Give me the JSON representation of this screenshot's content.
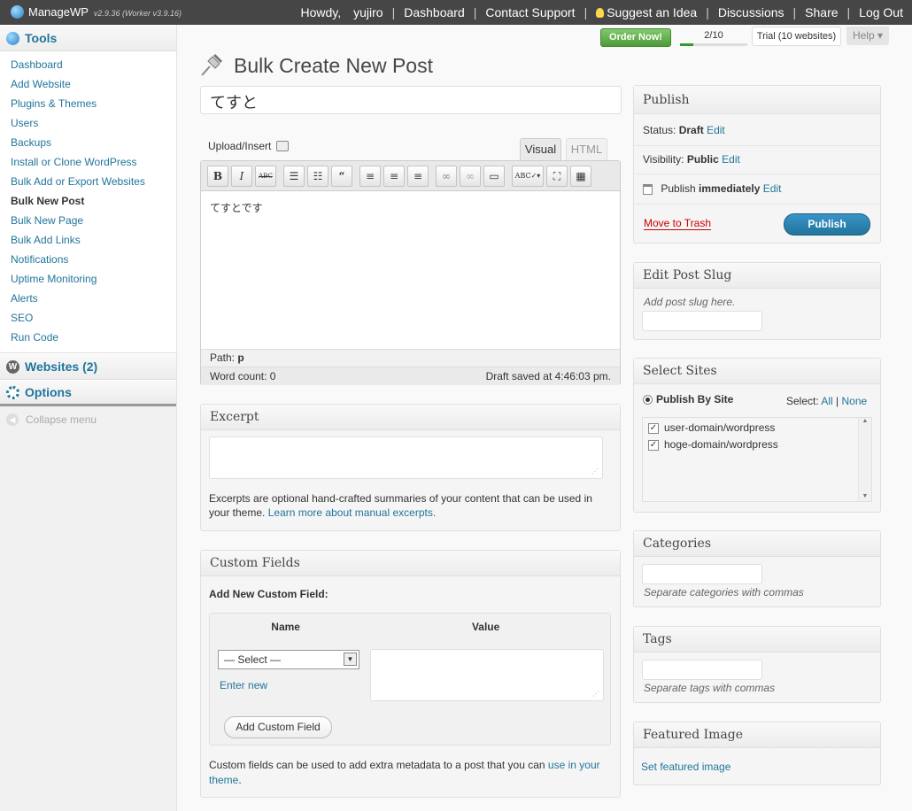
{
  "topbar": {
    "app_name": "ManageWP",
    "version": "v2.9.36 (Worker v3.9.16)",
    "howdy": "Howdy,",
    "user": "yujiro",
    "links": [
      "Dashboard",
      "Contact Support",
      "Suggest an Idea",
      "Discussions",
      "Share",
      "Log Out"
    ]
  },
  "sidebar": {
    "tools_label": "Tools",
    "items": [
      "Dashboard",
      "Add Website",
      "Plugins & Themes",
      "Users",
      "Backups",
      "Install or Clone WordPress",
      "Bulk Add or Export Websites",
      "Bulk New Post",
      "Bulk New Page",
      "Bulk Add Links",
      "Notifications",
      "Uptime Monitoring",
      "Alerts",
      "SEO",
      "Run Code"
    ],
    "current": "Bulk New Post",
    "websites_label": "Websites (2)",
    "options_label": "Options",
    "collapse_label": "Collapse menu"
  },
  "header": {
    "order_now": "Order Now!",
    "progress_text": "2/10",
    "progress_fraction": 0.2,
    "trial": "Trial (10 websites)",
    "help": "Help"
  },
  "page_title": "Bulk Create New Post",
  "post": {
    "title": "てすと",
    "upload_insert": "Upload/Insert",
    "tab_visual": "Visual",
    "tab_html": "HTML",
    "content": "てすとです",
    "path_label": "Path:",
    "path_value": "p",
    "word_count": "Word count: 0",
    "draft_saved": "Draft saved at 4:46:03 pm."
  },
  "toolbar_buttons": [
    "bold",
    "italic",
    "strikethrough",
    "bullet-list",
    "numbered-list",
    "blockquote",
    "align-left",
    "align-center",
    "align-right",
    "link",
    "unlink",
    "more",
    "spellcheck",
    "fullscreen",
    "kitchen-sink"
  ],
  "excerpt": {
    "title": "Excerpt",
    "help": "Excerpts are optional hand-crafted summaries of your content that can be used in your theme.",
    "link": "Learn more about manual excerpts."
  },
  "custom_fields": {
    "title": "Custom Fields",
    "add_new": "Add New Custom Field:",
    "col_name": "Name",
    "col_value": "Value",
    "select_default": "— Select —",
    "enter_new": "Enter new",
    "add_button": "Add Custom Field",
    "help": "Custom fields can be used to add extra metadata to a post that you can",
    "help_link": "use in your theme",
    "help_end": "."
  },
  "publish": {
    "title": "Publish",
    "status_label": "Status:",
    "status_value": "Draft",
    "visibility_label": "Visibility:",
    "visibility_value": "Public",
    "publish_label": "Publish",
    "publish_value": "immediately",
    "edit": "Edit",
    "trash": "Move to Trash",
    "publish_button": "Publish"
  },
  "slug": {
    "title": "Edit Post Slug",
    "hint": "Add post slug here."
  },
  "sites": {
    "title": "Select Sites",
    "publish_by": "Publish By Site",
    "select_label": "Select:",
    "all": "All",
    "none": "None",
    "list": [
      "user-domain/wordpress",
      "hoge-domain/wordpress"
    ]
  },
  "categories": {
    "title": "Categories",
    "hint": "Separate categories with commas"
  },
  "tags": {
    "title": "Tags",
    "hint": "Separate tags with commas"
  },
  "featured": {
    "title": "Featured Image",
    "link": "Set featured image"
  }
}
